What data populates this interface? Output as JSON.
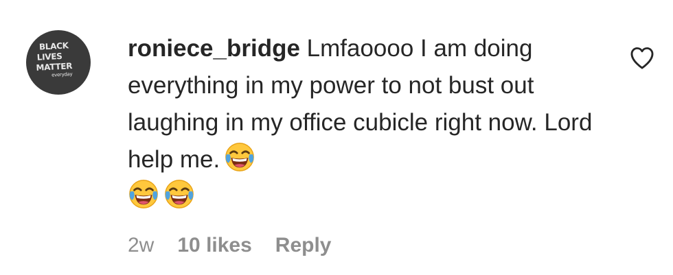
{
  "comment": {
    "avatar": {
      "lines": [
        "BLACK",
        "LIVES",
        "MATTER",
        "everyday"
      ]
    },
    "username": "roniece_bridge",
    "text": "Lmfaoooo I am doing everything in my power to not bust out laughing in my office cubicle right now. Lord help me.",
    "emojis": [
      "face-with-tears-of-joy",
      "face-with-tears-of-joy",
      "face-with-tears-of-joy"
    ],
    "time": "2w",
    "likes": "10 likes",
    "reply_label": "Reply",
    "like_icon": "heart-outline-icon"
  }
}
